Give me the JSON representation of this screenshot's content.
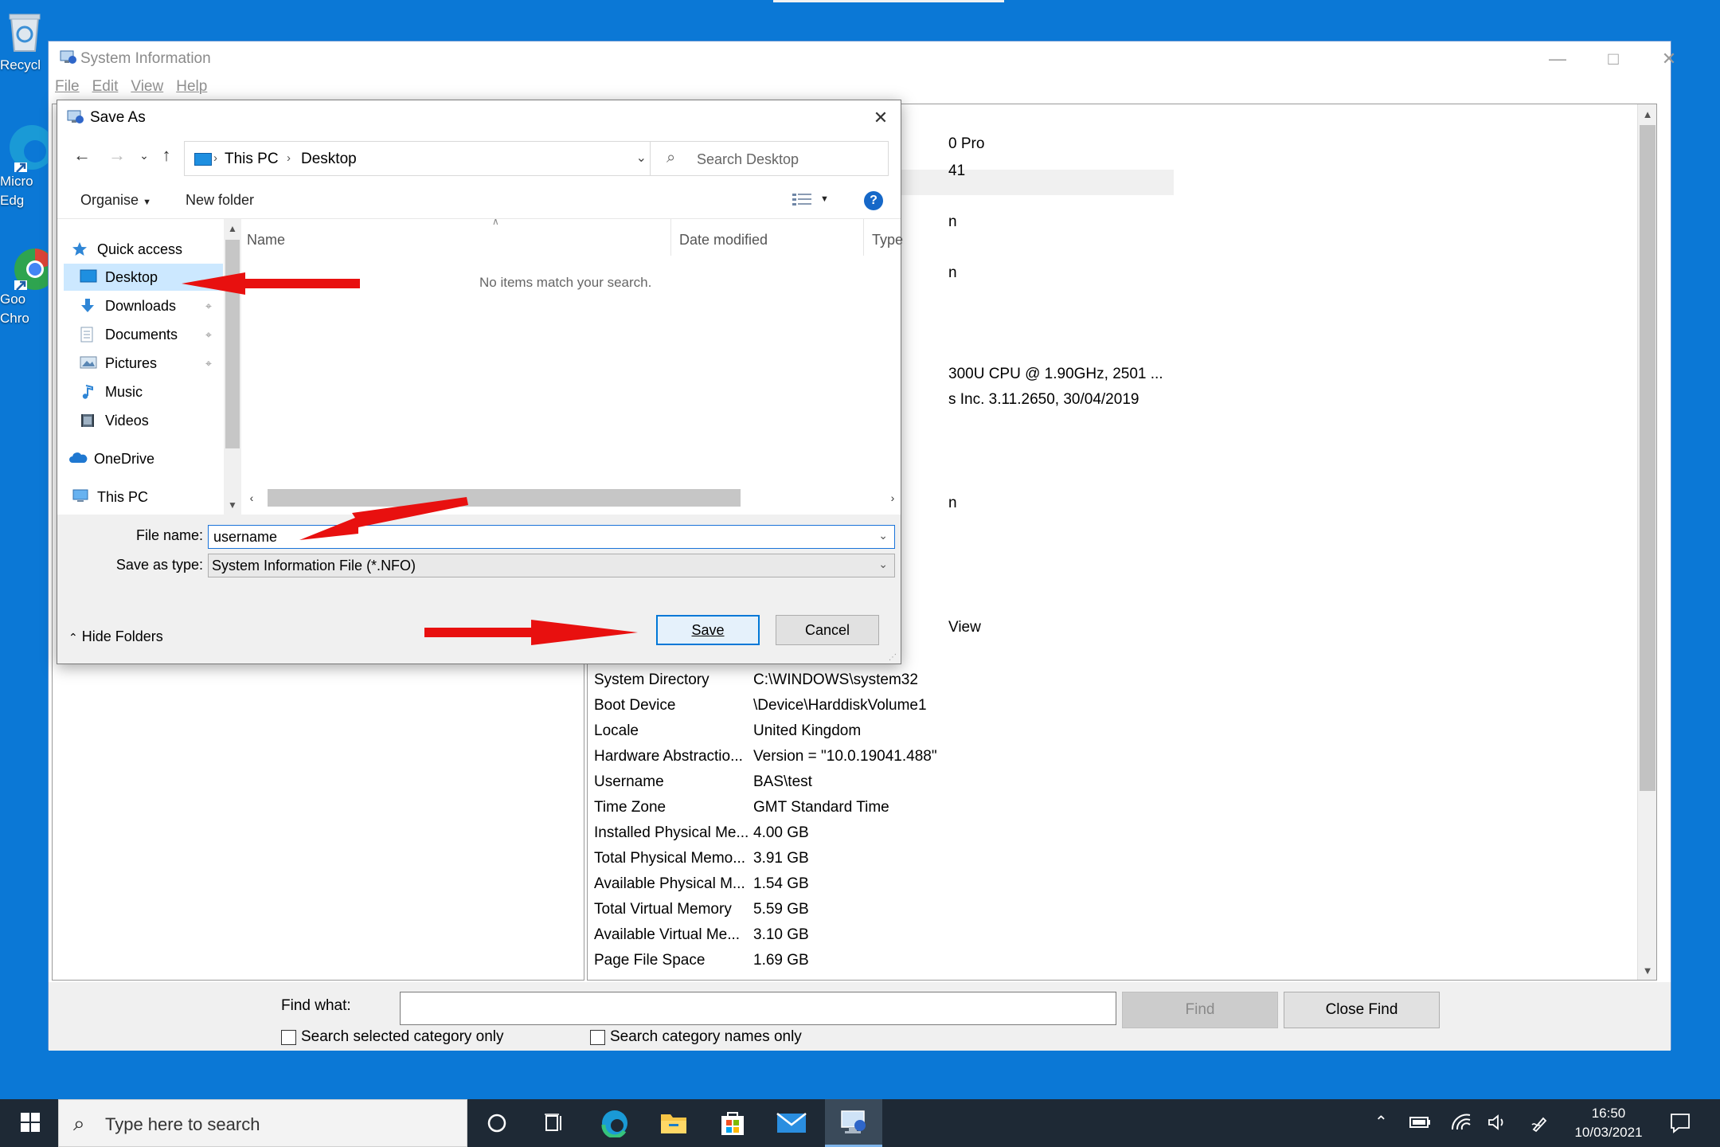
{
  "desktop": {
    "icons": [
      {
        "label": "Recycl"
      },
      {
        "label": "Micro\nEdg"
      },
      {
        "label": "Goo\nChro"
      }
    ]
  },
  "sysinfo": {
    "title": "System Information",
    "menu": [
      "File",
      "Edit",
      "View",
      "Help"
    ],
    "fragments": [
      {
        "text": "0 Pro"
      },
      {
        "text": "41"
      },
      {
        "text": "n"
      },
      {
        "text": "n"
      },
      {
        "text": "300U CPU @ 1.90GHz, 2501 ..."
      },
      {
        "text": "s Inc. 3.11.2650, 30/04/2019"
      },
      {
        "text": "n"
      },
      {
        "text": "View"
      }
    ],
    "rows": [
      {
        "item": "System Directory",
        "value": "C:\\WINDOWS\\system32"
      },
      {
        "item": "Boot Device",
        "value": "\\Device\\HarddiskVolume1"
      },
      {
        "item": "Locale",
        "value": "United Kingdom"
      },
      {
        "item": "Hardware Abstractio...",
        "value": "Version = \"10.0.19041.488\""
      },
      {
        "item": "Username",
        "value": "BAS\\test"
      },
      {
        "item": "Time Zone",
        "value": "GMT Standard Time"
      },
      {
        "item": "Installed Physical Me...",
        "value": "4.00 GB"
      },
      {
        "item": "Total Physical Memo...",
        "value": "3.91 GB"
      },
      {
        "item": "Available Physical M...",
        "value": "1.54 GB"
      },
      {
        "item": "Total Virtual Memory",
        "value": "5.59 GB"
      },
      {
        "item": "Available Virtual Me...",
        "value": "3.10 GB"
      },
      {
        "item": "Page File Space",
        "value": "1.69 GB"
      }
    ],
    "find": {
      "label": "Find what:",
      "value": "",
      "find_button": "Find",
      "close_button": "Close Find",
      "check_selected": "Search selected category only",
      "check_names": "Search category names only"
    }
  },
  "saveas": {
    "title": "Save As",
    "breadcrumb": [
      "This PC",
      "Desktop"
    ],
    "search_placeholder": "Search Desktop",
    "toolbar": {
      "organise": "Organise",
      "new_folder": "New folder"
    },
    "tree": [
      {
        "label": "Quick access",
        "icon": "star-icon",
        "selected": false,
        "pinned": false
      },
      {
        "label": "Desktop",
        "icon": "desktop-folder-icon",
        "selected": true,
        "pinned": false
      },
      {
        "label": "Downloads",
        "icon": "download-icon",
        "selected": false,
        "pinned": true
      },
      {
        "label": "Documents",
        "icon": "document-icon",
        "selected": false,
        "pinned": true
      },
      {
        "label": "Pictures",
        "icon": "picture-icon",
        "selected": false,
        "pinned": true
      },
      {
        "label": "Music",
        "icon": "music-icon",
        "selected": false,
        "pinned": false
      },
      {
        "label": "Videos",
        "icon": "video-icon",
        "selected": false,
        "pinned": false
      },
      {
        "label": "OneDrive",
        "icon": "cloud-icon",
        "selected": false,
        "pinned": false
      },
      {
        "label": "This PC",
        "icon": "computer-icon",
        "selected": false,
        "pinned": false
      }
    ],
    "columns": [
      "Name",
      "Date modified",
      "Type"
    ],
    "empty_message": "No items match your search.",
    "file_name_label": "File name:",
    "file_name_value": "username",
    "save_type_label": "Save as type:",
    "save_type_value": "System Information File (*.NFO)",
    "hide_folders": "Hide Folders",
    "save_button": "Save",
    "cancel_button": "Cancel"
  },
  "taskbar": {
    "search_placeholder": "Type here to search",
    "time": "16:50",
    "date": "10/03/2021"
  },
  "colors": {
    "desktop": "#0b78d6",
    "taskbar": "#1e2935",
    "accent": "#0078d7",
    "annotation_arrow": "#e8100f"
  }
}
